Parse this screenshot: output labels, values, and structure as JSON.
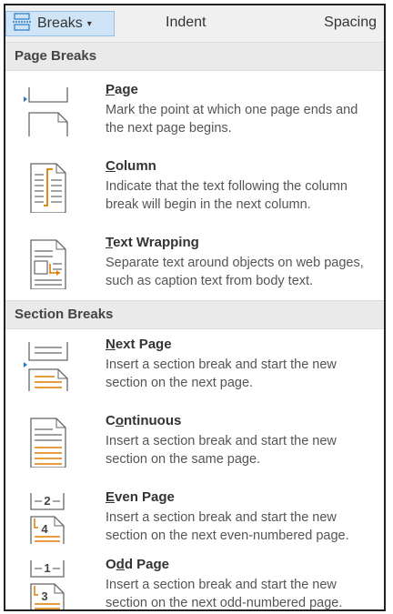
{
  "ribbon": {
    "breaks_label": "Breaks",
    "indent_label": "Indent",
    "spacing_label": "Spacing"
  },
  "page_breaks": {
    "header": "Page Breaks",
    "items": [
      {
        "mn": "P",
        "rest": "age",
        "desc": "Mark the point at which one page ends and the next page begins."
      },
      {
        "mn": "C",
        "rest": "olumn",
        "desc": "Indicate that the text following the column break will begin in the next column."
      },
      {
        "mn": "T",
        "rest": "ext Wrapping",
        "desc": "Separate text around objects on web pages, such as caption text from body text."
      }
    ]
  },
  "section_breaks": {
    "header": "Section Breaks",
    "items": [
      {
        "mn": "N",
        "rest": "ext Page",
        "desc": "Insert a section break and start the new section on the next page."
      },
      {
        "pre": "C",
        "mn": "o",
        "rest": "ntinuous",
        "desc": "Insert a section break and start the new section on the same page."
      },
      {
        "mn": "E",
        "rest": "ven Page",
        "desc": "Insert a section break and start the new section on the next even-numbered page.",
        "n1": "2",
        "n2": "4"
      },
      {
        "pre": "O",
        "mn": "d",
        "rest": "d Page",
        "desc": "Insert a section break and start the new section on the next odd-numbered page.",
        "n1": "1",
        "n2": "3"
      }
    ]
  },
  "colors": {
    "accent": "#e07b00",
    "selection": "#cfe4f7",
    "marker": "#2b79c2"
  }
}
